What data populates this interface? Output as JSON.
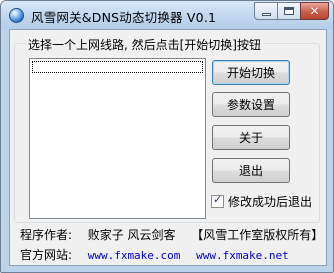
{
  "window": {
    "title": "风雪网关&DNS动态切换器 V0.1"
  },
  "titlebar_buttons": {
    "minimize": "minimize",
    "maximize": "maximize",
    "close": "close"
  },
  "group": {
    "legend": "选择一个上网线路, 然后点击[开始切换]按钮"
  },
  "buttons": {
    "start": "开始切换",
    "settings": "参数设置",
    "about": "关于",
    "exit": "退出"
  },
  "option": {
    "exit_on_success_label": "修改成功后退出",
    "exit_on_success_checked": true
  },
  "footer": {
    "author_label": "程序作者:",
    "author_names": "败家子 风云剑客",
    "copyright": "【风雪工作室版权所有】",
    "site_label": "官方网站:",
    "site_url_1": "www.fxmake.com",
    "site_url_2": "www.fxmake.net"
  },
  "icons": {
    "app": "globe-icon",
    "minimize": "minimize-icon",
    "maximize": "maximize-icon",
    "close": "close-icon",
    "check": "checkmark-icon"
  }
}
